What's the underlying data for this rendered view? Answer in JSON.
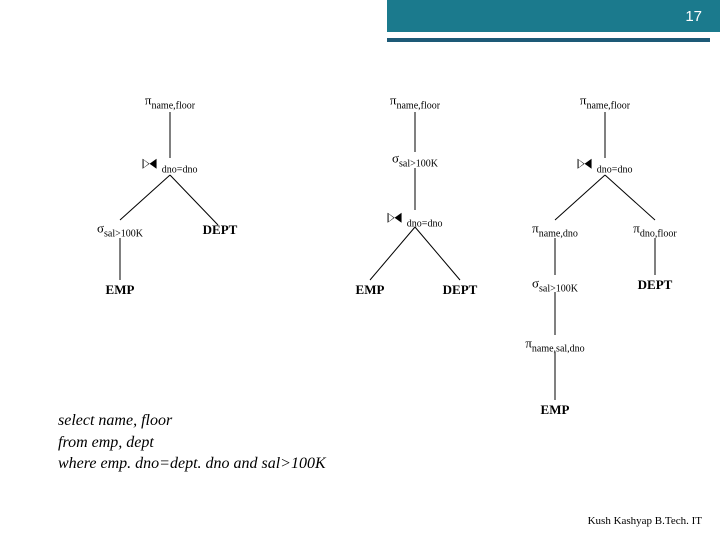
{
  "header": {
    "page_number": "17"
  },
  "symbols": {
    "pi": "π",
    "sigma": "σ"
  },
  "labels": {
    "name_floor": "name,floor",
    "dno_dno": "dno=dno",
    "sal_cond": "sal>100K",
    "name_dno": "name,dno",
    "dno_floor": "dno,floor",
    "name_sal_dno": "name,sal,dno",
    "emp": "EMP",
    "dept": "DEPT"
  },
  "sql": {
    "line1": "select name, floor",
    "line2": "from emp, dept",
    "line3": "where emp. dno=dept. dno and sal>100K"
  },
  "footer": {
    "author": "Kush Kashyap B.Tech. IT"
  }
}
